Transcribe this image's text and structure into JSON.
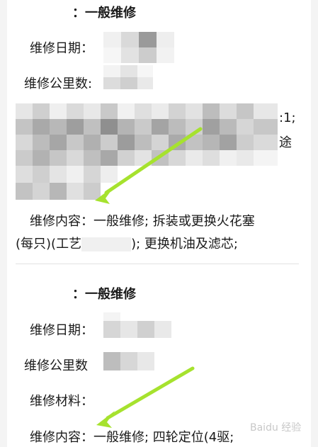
{
  "records": [
    {
      "title": "：一般维修",
      "date_label": "维修日期：",
      "mileage_label": "维修公里数",
      "mileage_sep": ":",
      "mileage_tail": "_________",
      "materials_tail_1": ":1;",
      "materials_tail_2": "途",
      "content_label": "维修内容：",
      "content_value": "一般维修; 拆装或更换火花塞",
      "content_line2_a": "(每只)(工艺",
      "content_line2_b": "); 更换机油及滤芯;"
    },
    {
      "title": "：一般维修",
      "date_label": "维修日期：",
      "mileage_label": "维修公里数",
      "materials_label": "维修材料：",
      "content_label": "维修内容：",
      "content_value": "一般维修; 四轮定位(4驱;"
    }
  ],
  "annotation_color": "#a6e22e",
  "watermark": "Baidu 经验"
}
